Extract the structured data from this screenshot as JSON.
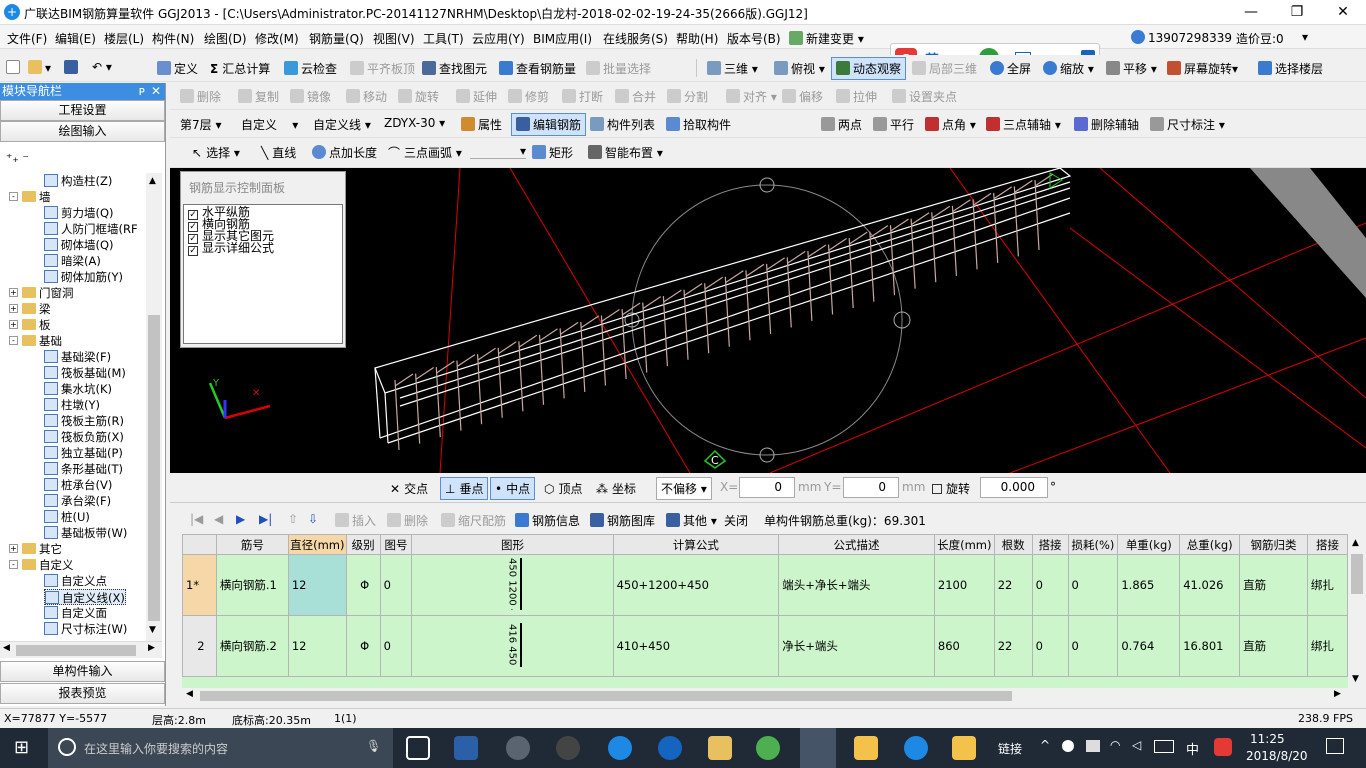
{
  "titlebar": {
    "title": "广联达BIM钢筋算量软件 GGJ2013 - [C:\\Users\\Administrator.PC-20141127NRHM\\Desktop\\白龙村-2018-02-02-19-24-35(2666版).GGJ12]",
    "minimize": "—",
    "restore": "❐",
    "close": "✕"
  },
  "menu": {
    "items": [
      "文件(F)",
      "编辑(E)",
      "楼层(L)",
      "构件(N)",
      "绘图(D)",
      "修改(M)",
      "钢筋量(Q)",
      "视图(V)",
      "工具(T)",
      "云应用(Y)",
      "BIM应用(I)",
      "在线服务(S)",
      "帮助(H)",
      "版本号(B)",
      "新建变更"
    ],
    "ime_label": "英",
    "phone": "13907298339",
    "cost_label": "造价豆:0"
  },
  "toolbar1": {
    "items": [
      "定义",
      "汇总计算",
      "云检查",
      "平齐板顶",
      "查找图元",
      "查看钢筋量",
      "批量选择",
      "三维",
      "俯视",
      "动态观察",
      "局部三维",
      "全屏",
      "缩放",
      "平移",
      "屏幕旋转",
      "选择楼层"
    ]
  },
  "toolbar2": {
    "items": [
      "删除",
      "复制",
      "镜像",
      "移动",
      "旋转",
      "延伸",
      "修剪",
      "打断",
      "合并",
      "分割",
      "对齐",
      "偏移",
      "拉伸",
      "设置夹点"
    ]
  },
  "toolbar3": {
    "floor": "第7层",
    "category": "自定义",
    "type": "自定义线",
    "element": "ZDYX-30",
    "items": [
      "属性",
      "编辑钢筋",
      "构件列表",
      "拾取构件",
      "两点",
      "平行",
      "点角",
      "三点辅轴",
      "删除辅轴",
      "尺寸标注"
    ]
  },
  "toolbar4": {
    "items": [
      "选择",
      "直线",
      "点加长度",
      "三点画弧",
      "矩形",
      "智能布置"
    ]
  },
  "nav": {
    "header": "模块导航栏",
    "pin": "📌",
    "close": "✕",
    "btn_project": "工程设置",
    "btn_draw": "绘图输入",
    "btn_single": "单构件输入",
    "btn_report": "报表预览",
    "tree": [
      {
        "label": "构造柱(Z)",
        "level": 2
      },
      {
        "label": "墙",
        "level": 1,
        "folder": true,
        "exp": "-"
      },
      {
        "label": "剪力墙(Q)",
        "level": 2
      },
      {
        "label": "人防门框墙(RF",
        "level": 2
      },
      {
        "label": "砌体墙(Q)",
        "level": 2
      },
      {
        "label": "暗梁(A)",
        "level": 2
      },
      {
        "label": "砌体加筋(Y)",
        "level": 2
      },
      {
        "label": "门窗洞",
        "level": 1,
        "folder": true,
        "exp": "+"
      },
      {
        "label": "梁",
        "level": 1,
        "folder": true,
        "exp": "+"
      },
      {
        "label": "板",
        "level": 1,
        "folder": true,
        "exp": "+"
      },
      {
        "label": "基础",
        "level": 1,
        "folder": true,
        "exp": "-"
      },
      {
        "label": "基础梁(F)",
        "level": 2
      },
      {
        "label": "筏板基础(M)",
        "level": 2
      },
      {
        "label": "集水坑(K)",
        "level": 2
      },
      {
        "label": "柱墩(Y)",
        "level": 2
      },
      {
        "label": "筏板主筋(R)",
        "level": 2
      },
      {
        "label": "筏板负筋(X)",
        "level": 2
      },
      {
        "label": "独立基础(P)",
        "level": 2
      },
      {
        "label": "条形基础(T)",
        "level": 2
      },
      {
        "label": "桩承台(V)",
        "level": 2
      },
      {
        "label": "承台梁(F)",
        "level": 2
      },
      {
        "label": "桩(U)",
        "level": 2
      },
      {
        "label": "基础板带(W)",
        "level": 2
      },
      {
        "label": "其它",
        "level": 1,
        "folder": true,
        "exp": "+"
      },
      {
        "label": "自定义",
        "level": 1,
        "folder": true,
        "exp": "-"
      },
      {
        "label": "自定义点",
        "level": 2
      },
      {
        "label": "自定义线(X)",
        "level": 2,
        "selected": true
      },
      {
        "label": "自定义面",
        "level": 2
      },
      {
        "label": "尺寸标注(W)",
        "level": 2
      }
    ]
  },
  "rebar_panel": {
    "title": "钢筋显示控制面板",
    "options": [
      "水平纵筋",
      "横向钢筋",
      "显示其它图元",
      "显示详细公式"
    ]
  },
  "canvas": {
    "axis_y": "Y",
    "marker": "C"
  },
  "snapbar": {
    "items": [
      "交点",
      "垂点",
      "中点",
      "顶点",
      "坐标"
    ],
    "offset_mode": "不偏移",
    "x_label": "X=",
    "x_value": "0",
    "mm1": "mm",
    "y_label": "Y=",
    "y_value": "0",
    "mm2": "mm",
    "rotate_label": "旋转",
    "rotate_value": "0.000",
    "degree": "°"
  },
  "tabletb": {
    "items": [
      "插入",
      "删除",
      "缩尺配筋",
      "钢筋信息",
      "钢筋图库",
      "其他",
      "关闭"
    ],
    "total": "单构件钢筋总重(kg)：69.301"
  },
  "grid": {
    "columns": [
      "",
      "筋号",
      "直径(mm)",
      "级别",
      "图号",
      "图形",
      "计算公式",
      "公式描述",
      "长度(mm)",
      "根数",
      "搭接",
      "损耗(%)",
      "单重(kg)",
      "总重(kg)",
      "钢筋归类",
      "搭接"
    ],
    "rows": [
      {
        "idx": "1*",
        "name": "横向钢筋.1",
        "dia": "12",
        "grade": "Φ",
        "fig": "0",
        "shape": "450 1200 450",
        "formula": "450+1200+450",
        "desc": "端头+净长+端头",
        "len": "2100",
        "count": "22",
        "lap": "0",
        "loss": "0",
        "unit": "1.865",
        "total": "41.026",
        "cat": "直筋",
        "lap2": "绑扎"
      },
      {
        "idx": "2",
        "name": "横向钢筋.2",
        "dia": "12",
        "grade": "Φ",
        "fig": "0",
        "shape": "416 450",
        "formula": "410+450",
        "desc": "净长+端头",
        "len": "860",
        "count": "22",
        "lap": "0",
        "loss": "0",
        "unit": "0.764",
        "total": "16.801",
        "cat": "直筋",
        "lap2": "绑扎"
      }
    ]
  },
  "status": {
    "coords": "X=77877 Y=-5577",
    "floor_height": "层高:2.8m",
    "base_height": "底标高:20.35m",
    "count": "1(1)",
    "fps": "238.9 FPS"
  },
  "taskbar": {
    "search_placeholder": "在这里输入你要搜索的内容",
    "link": "链接",
    "ime": "中",
    "time": "11:25",
    "date": "2018/8/20"
  }
}
